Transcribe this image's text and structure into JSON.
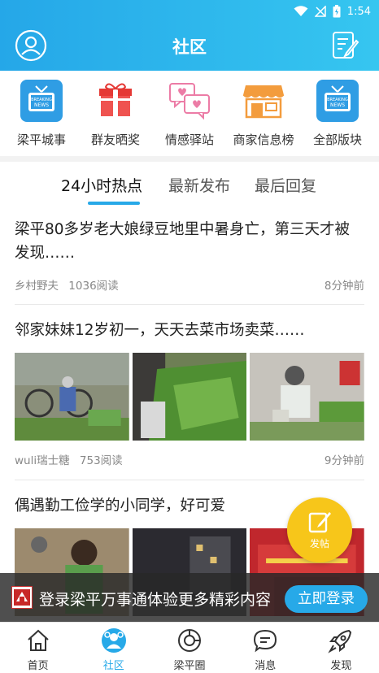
{
  "status_bar": {
    "time": "1:54"
  },
  "header": {
    "title": "社区"
  },
  "quick_links": [
    {
      "label": "梁平城事",
      "icon": "news-tv-icon"
    },
    {
      "label": "群友晒奖",
      "icon": "gift-icon"
    },
    {
      "label": "情感驿站",
      "icon": "heart-chat-icon"
    },
    {
      "label": "商家信息榜",
      "icon": "shop-icon"
    },
    {
      "label": "全部版块",
      "icon": "news-tv-icon"
    }
  ],
  "tabs": [
    {
      "label": "24小时热点",
      "active": true
    },
    {
      "label": "最新发布",
      "active": false
    },
    {
      "label": "最后回复",
      "active": false
    }
  ],
  "posts": [
    {
      "title": "梁平80多岁老大娘绿豆地里中暑身亡，第三天才被发现……",
      "author": "乡村野夫",
      "reads": "1036阅读",
      "time": "8分钟前"
    },
    {
      "title": "邻家妹妹12岁初一，天天去菜市场卖菜……",
      "author": "wuli瑞士糖",
      "reads": "753阅读",
      "time": "9分钟前"
    },
    {
      "title": "偶遇勤工俭学的小同学，好可爱"
    }
  ],
  "post_button": {
    "label": "发帖"
  },
  "login_bar": {
    "text": "登录梁平万事通体验更多精彩内容",
    "button": "立即登录"
  },
  "bottom_nav": [
    {
      "label": "首页"
    },
    {
      "label": "社区"
    },
    {
      "label": "梁平圈"
    },
    {
      "label": "消息"
    },
    {
      "label": "发现"
    }
  ],
  "colors": {
    "accent": "#27a9e8",
    "header_start": "#25a7e8",
    "header_end": "#36c6f0",
    "post_button": "#f7c61a"
  }
}
